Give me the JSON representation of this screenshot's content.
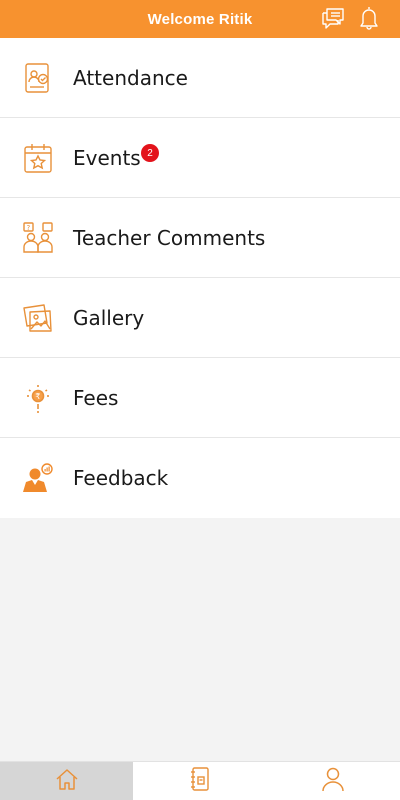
{
  "header": {
    "title": "Welcome Ritik",
    "icons": [
      "chat-icon",
      "bell-icon"
    ]
  },
  "menu": {
    "items": [
      {
        "label": "Attendance",
        "icon": "attendance-icon"
      },
      {
        "label": "Events",
        "icon": "calendar-star-icon",
        "badge": "2"
      },
      {
        "label": "Teacher Comments",
        "icon": "teacher-comments-icon"
      },
      {
        "label": "Gallery",
        "icon": "gallery-icon"
      },
      {
        "label": "Fees",
        "icon": "fees-icon"
      },
      {
        "label": "Feedback",
        "icon": "feedback-icon"
      }
    ]
  },
  "bottom_nav": {
    "tabs": [
      {
        "icon": "home-icon",
        "active": true
      },
      {
        "icon": "notebook-icon",
        "active": false
      },
      {
        "icon": "profile-icon",
        "active": false
      }
    ]
  },
  "colors": {
    "accent": "#f7922f",
    "badge": "#e3131b",
    "icon": "#e8913a"
  }
}
